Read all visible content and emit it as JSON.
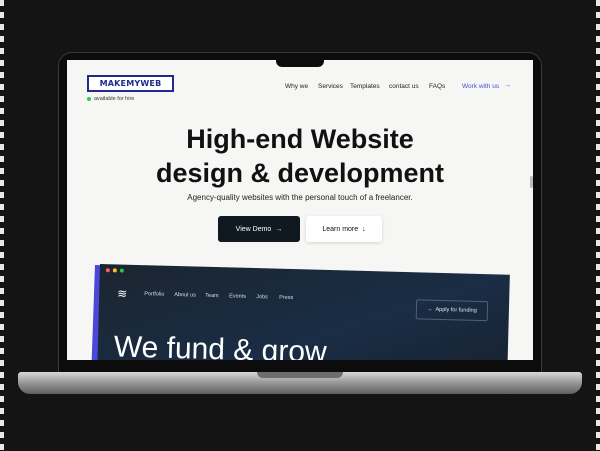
{
  "brand": {
    "name": "MAKEMYWEB",
    "status": "available for hire"
  },
  "nav": {
    "items": [
      "Why we",
      "Services",
      "Templates",
      "contact us",
      "FAQs"
    ],
    "cta": "Work with us",
    "cta_icon": "arrow-right-icon"
  },
  "hero": {
    "title_line1": "High-end Website",
    "title_line2": "design & development",
    "subtitle": "Agency-quality websites with the personal touch of a freelancer.",
    "primary_button": "View Demo",
    "secondary_button": "Learn more"
  },
  "preview": {
    "nav": [
      "Portfolio",
      "About us",
      "Team",
      "Events",
      "Jobs",
      "Press"
    ],
    "cta": "Apply for funding",
    "headline": "We fund & grow"
  },
  "colors": {
    "accent": "#4b4bd8",
    "dark": "#101820",
    "preview_bg": "#1a2d45",
    "status_dot": "#2ecc40"
  }
}
